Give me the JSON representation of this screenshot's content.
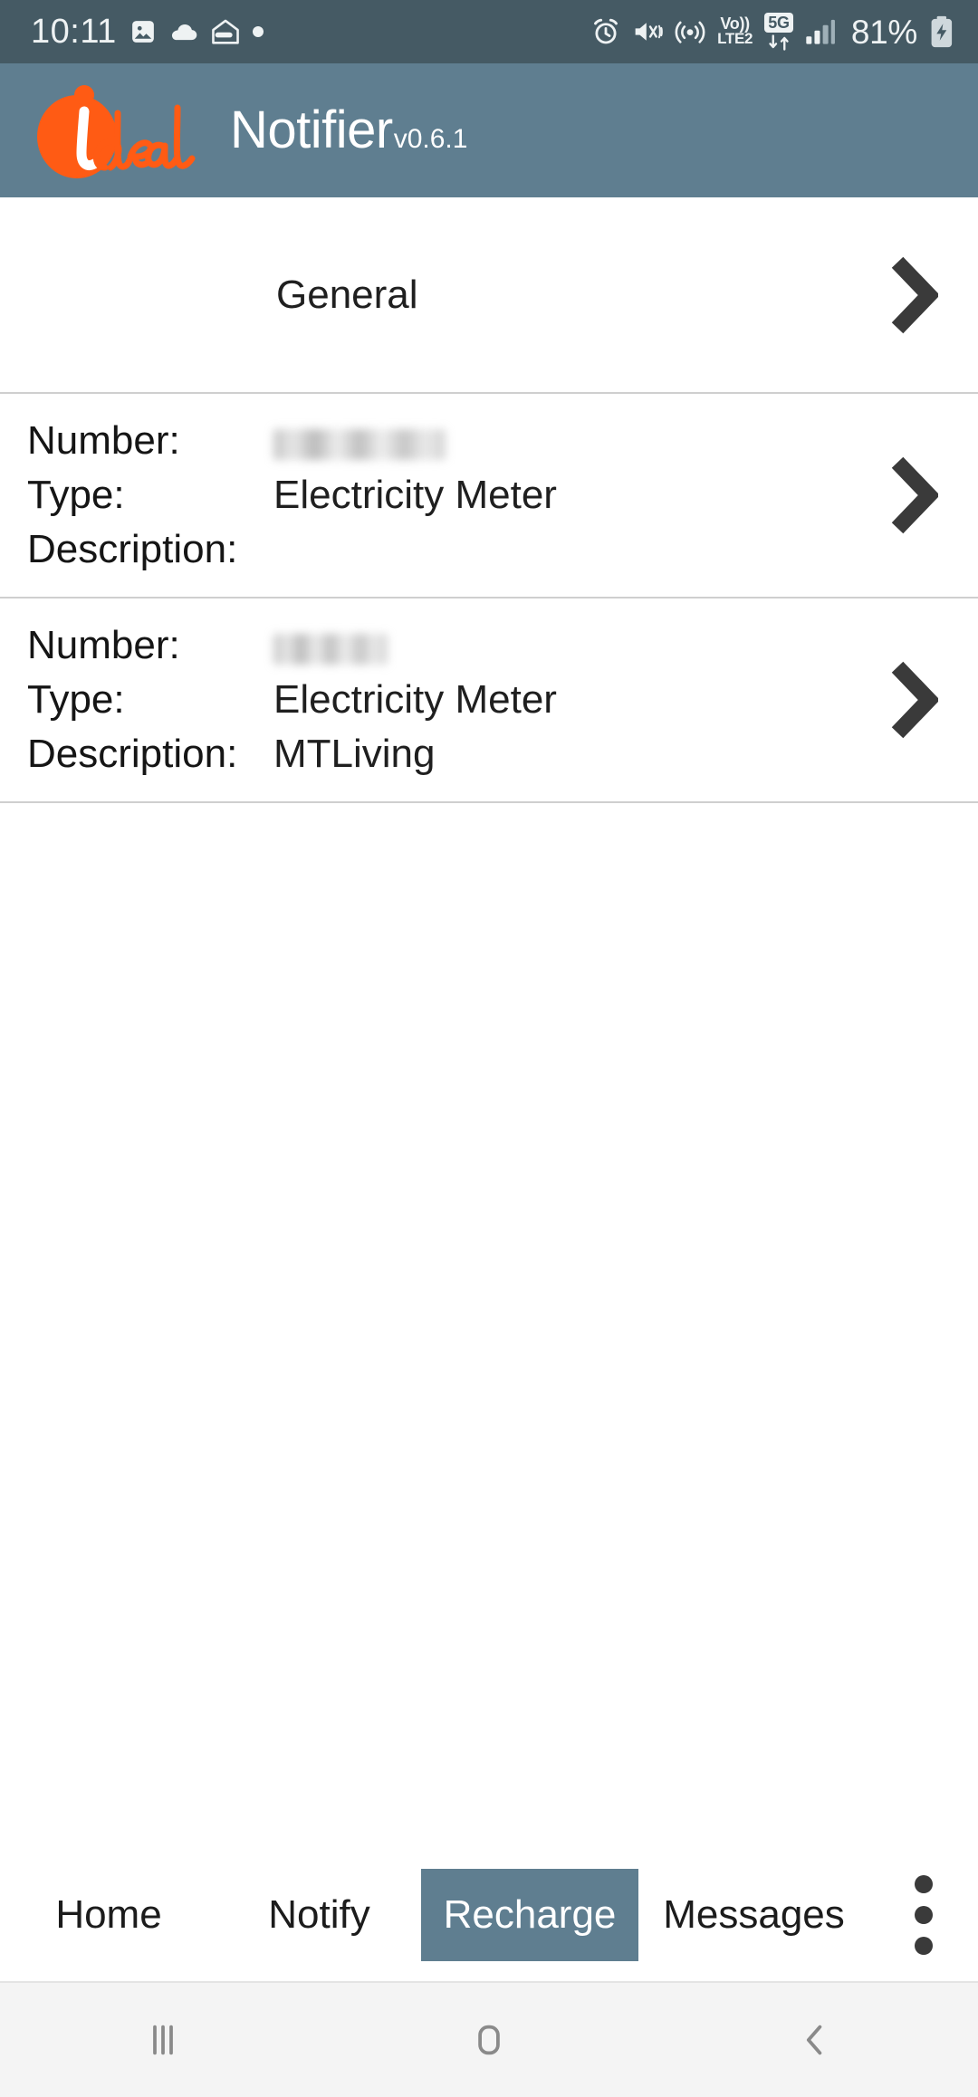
{
  "status_bar": {
    "time": "10:11",
    "battery_percent": "81%",
    "network_voice": {
      "line1": "Vo))",
      "line2": "LTE2"
    },
    "network_data": "5G",
    "left_icons": [
      "image-icon",
      "cloud-icon",
      "mail-open-icon",
      "dot-icon"
    ],
    "right_icons": [
      "alarm-icon",
      "mute-vibrate-icon",
      "hotspot-icon",
      "volte-icon",
      "5g-data-icon",
      "signal-bars-icon",
      "battery-charging-icon"
    ],
    "bg_color": "#455A64",
    "fg_color": "#EEF2F3"
  },
  "app_bar": {
    "logo_text": "ideal",
    "title": "Notifier",
    "version": "v0.6.1",
    "bg_color": "#5F7E90",
    "logo_color": "#FF5B14",
    "title_color": "#FFFFFF"
  },
  "list": {
    "general_row": {
      "label": "General",
      "chevron": "chevron-right-icon"
    },
    "field_labels": {
      "number": "Number:",
      "type": "Type:",
      "description": "Description:"
    },
    "meters": [
      {
        "number": "",
        "number_redacted": true,
        "type": "Electricity Meter",
        "description": "",
        "chevron": "chevron-right-icon"
      },
      {
        "number": "",
        "number_redacted": true,
        "type": "Electricity Meter",
        "description": "MTLiving",
        "chevron": "chevron-right-icon"
      }
    ]
  },
  "tab_bar": {
    "tabs": [
      {
        "label": "Home",
        "selected": false
      },
      {
        "label": "Notify",
        "selected": false
      },
      {
        "label": "Recharge",
        "selected": true
      },
      {
        "label": "Messages",
        "selected": false
      }
    ],
    "overflow_icon": "more-vertical-icon",
    "selected_bg": "#5F7E90",
    "selected_fg": "#FFFFFF"
  },
  "nav_bar": {
    "buttons": [
      "recents-icon",
      "home-icon",
      "back-icon"
    ],
    "bg_color": "#F4F4F4",
    "icon_color": "#8A8A8A"
  }
}
